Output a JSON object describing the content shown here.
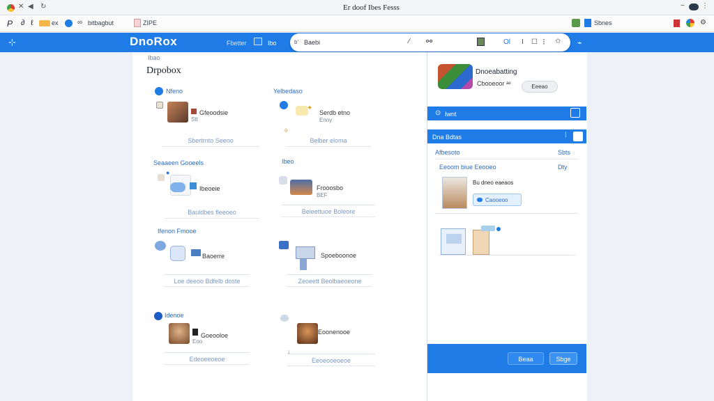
{
  "browser": {
    "window_title": "Er doof Ibes Fesss",
    "bookmarks": [
      "ex",
      "bitbagbut",
      "ZIPE",
      "Sbnes"
    ],
    "nav_glyphs": [
      "P",
      "∂",
      "ℓ"
    ]
  },
  "appbar": {
    "logo": "DnoRox",
    "nav": [
      "Fbetter",
      "Ibo"
    ],
    "search_prefix": "b'",
    "search_text": "Baebi",
    "search_glyphs": [
      "⁄",
      "Ol",
      "I"
    ]
  },
  "main": {
    "breadcrumb": "Ibao",
    "title": "Drpobox",
    "sections": [
      {
        "label": "Nfeno",
        "items": [
          {
            "title": "Gfeoodsie",
            "sub": "Stt",
            "action": "Sbertrnto Seeno"
          }
        ]
      },
      {
        "label": "Yelbedaso",
        "items": [
          {
            "title": "Serdb etno",
            "sub": "Enoy",
            "action": "Belber eloma"
          }
        ]
      },
      {
        "label": "Seaaeen Gooeels",
        "items": [
          {
            "title": "Ibeoeie",
            "sub": "",
            "action": "Bauldbes fleeoeo"
          }
        ]
      },
      {
        "label": "Ibeo",
        "items": [
          {
            "title": "Frooosbo",
            "sub": "BEF",
            "action": "Beieettuoe Boleore"
          }
        ]
      },
      {
        "label": "Ifenon Fmooe",
        "items": [
          {
            "title": "Baoerre",
            "sub": "",
            "action": "Loe deeoo Bdfelb doste"
          }
        ]
      },
      {
        "label": "",
        "items": [
          {
            "title": "Spoeboonoe",
            "sub": "",
            "action": "Zeoeett Beolbaeoeone"
          }
        ]
      },
      {
        "label": "Idenoe",
        "items": [
          {
            "title": "Goeooloe",
            "sub": "Eoo",
            "action": "Edeoeeoeoe"
          }
        ]
      },
      {
        "label": "",
        "items": [
          {
            "title": "Eoonenooe",
            "sub": "",
            "action": "Eeoeooeoeoe"
          }
        ]
      }
    ]
  },
  "side": {
    "profile_name": "Dnoeabatting",
    "profile_sub": "Cbooeoor ᵃᵉ",
    "profile_pill": "Eeeao",
    "row1_label": "Iwnt",
    "row2_label": "Dna Bdtas",
    "stat1_label": "Afbesoto",
    "stat1_value": "Sbts",
    "stat2_label": "Eeoom biue Eeooeo",
    "stat2_value": "Dty",
    "file_title": "Bu dneo eaeaos",
    "file_button": "Caooeoo",
    "footer_cancel": "Beaa",
    "footer_ok": "Sbge"
  }
}
